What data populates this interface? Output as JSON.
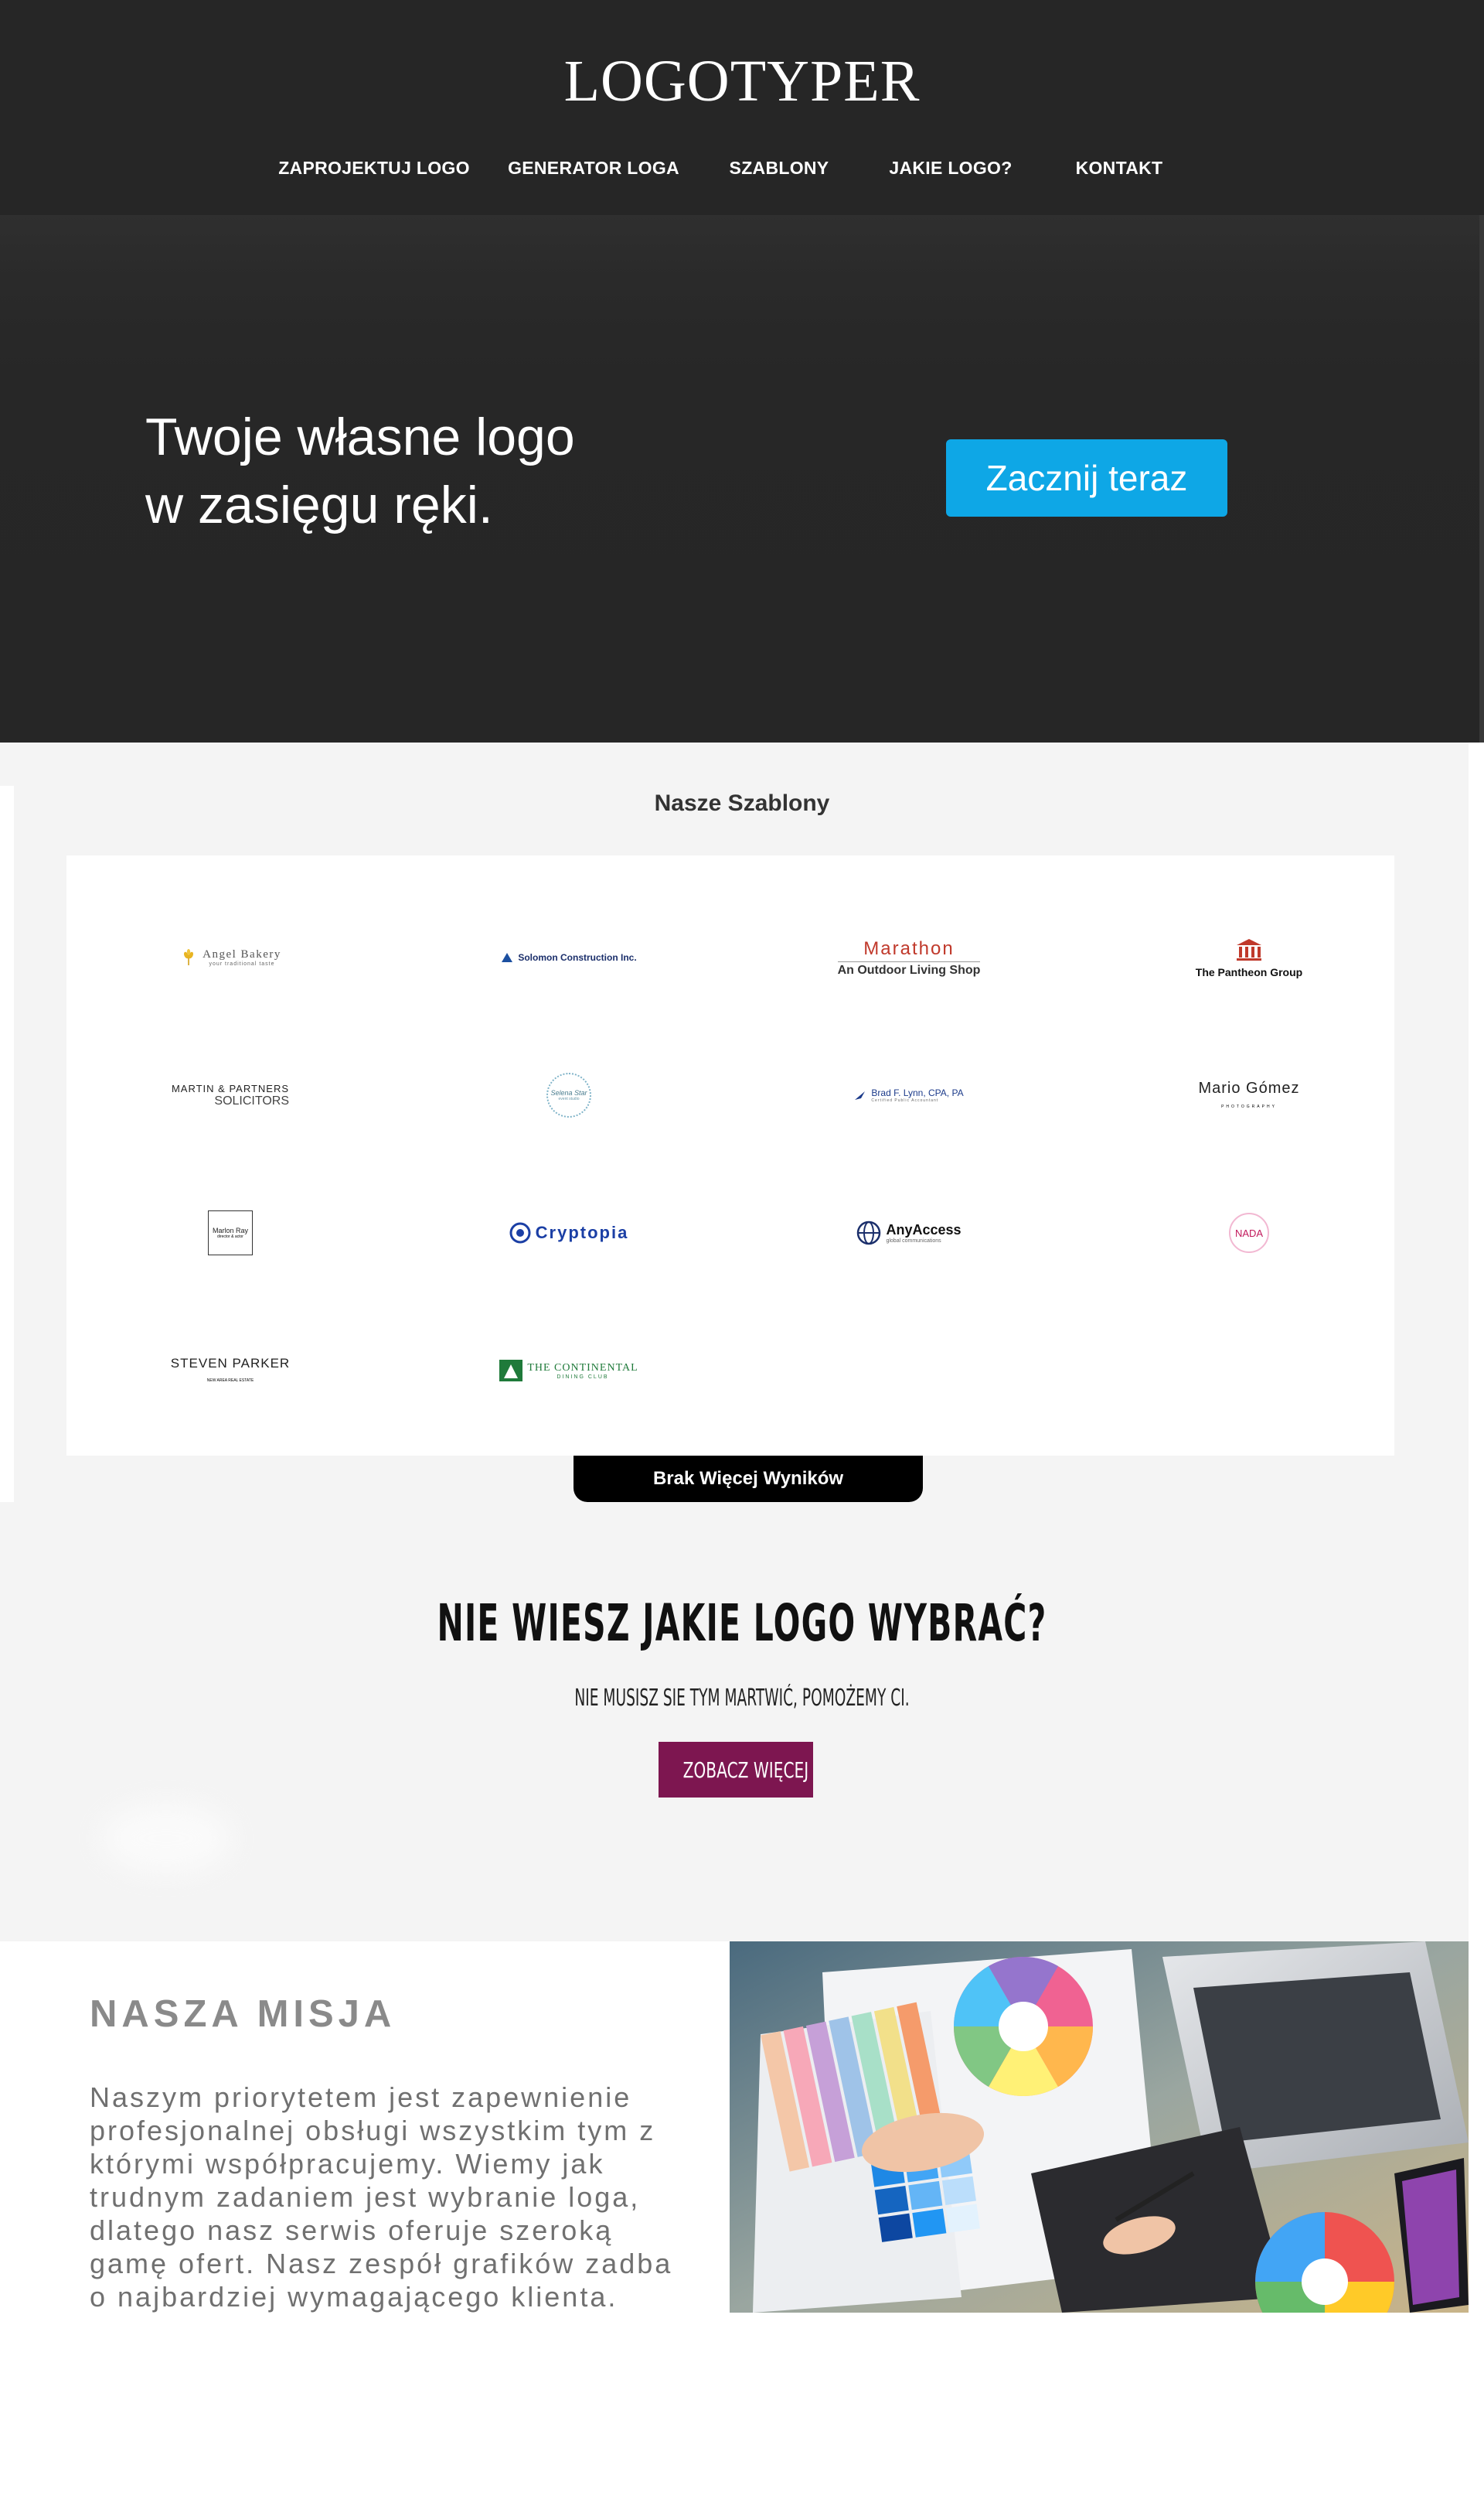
{
  "site": {
    "logo": "LOGOTYPER"
  },
  "nav": [
    {
      "label": "ZAPROJEKTUJ LOGO"
    },
    {
      "label": "GENERATOR LOGA"
    },
    {
      "label": "SZABLONY"
    },
    {
      "label": "JAKIE LOGO?"
    },
    {
      "label": "KONTAKT"
    }
  ],
  "hero": {
    "line1": "Twoje własne logo",
    "line2": "w zasięgu ręki.",
    "cta": "Zacznij teraz"
  },
  "templates": {
    "title": "Nasze Szablony",
    "logos": [
      {
        "name": "Angel Bakery",
        "sub": "your traditional taste"
      },
      {
        "name": "Solomon Construction Inc."
      },
      {
        "name": "Marathon",
        "sub": "An Outdoor Living Shop"
      },
      {
        "name": "The Pantheon Group"
      },
      {
        "name": "MARTIN & PARTNERS",
        "sub": "SOLICITORS"
      },
      {
        "name": "Selena Star",
        "sub": "event studio"
      },
      {
        "name": "Brad F. Lynn, CPA, PA",
        "sub": "Certified Public Accountant"
      },
      {
        "name": "Mario Gómez",
        "sub": "PHOTOGRAPHY"
      },
      {
        "name": "Marlon Ray",
        "sub": "director & actor"
      },
      {
        "name": "Cryptopia"
      },
      {
        "name": "AnyAccess",
        "sub": "global communications"
      },
      {
        "name": "NADA"
      },
      {
        "name": "STEVEN PARKER",
        "sub": "NEW AREA REAL ESTATE"
      },
      {
        "name": "THE CONTINENTAL",
        "sub": "DINING CLUB"
      }
    ],
    "no_more": "Brak Więcej Wyników"
  },
  "help": {
    "title": "NIE WIESZ JAKIE LOGO WYBRAĆ?",
    "subtitle": "NIE MUSISZ SIE TYM MARTWIĆ, POMOŻEMY CI.",
    "button": "ZOBACZ WIĘCEJ"
  },
  "mission": {
    "title": "NASZA MISJA",
    "lines": [
      "Naszym priorytetem jest zapewnienie",
      "profesjonalnej obsługi wszystkim tym z",
      "którymi współpracujemy. Wiemy jak",
      "trudnym zadaniem jest wybranie loga,",
      "dlatego nasz serwis oferuje szeroką",
      "gamę ofert. Nasz zespół grafików zadba",
      "o najbardziej wymagającego klienta."
    ]
  },
  "colors": {
    "header_bg": "#262626",
    "cta": "#0ea7e6",
    "help_button": "#7d1650",
    "section_bg": "#f4f4f4"
  }
}
